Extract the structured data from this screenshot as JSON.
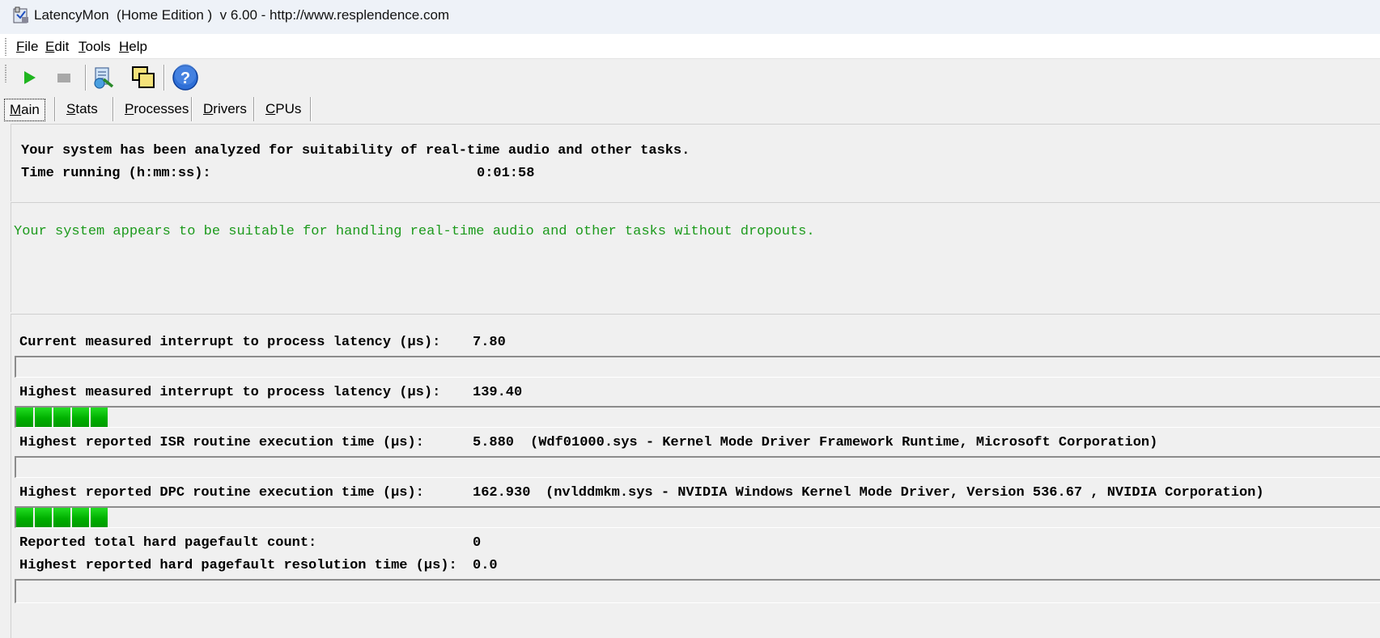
{
  "window": {
    "title": "LatencyMon  (Home Edition )  v 6.00 - http://www.resplendence.com"
  },
  "menu": [
    {
      "key": "F",
      "rest": "ile"
    },
    {
      "key": "E",
      "rest": "dit"
    },
    {
      "key": "T",
      "rest": "ools"
    },
    {
      "key": "H",
      "rest": "elp"
    }
  ],
  "toolbar": {
    "buttons": [
      "play-icon",
      "stop-icon",
      "analyze-icon",
      "windows-icon",
      "help-icon"
    ]
  },
  "tabs": [
    {
      "key": "M",
      "rest": "ain",
      "active": true
    },
    {
      "key": "S",
      "rest": "tats",
      "active": false
    },
    {
      "key": "P",
      "rest": "rocesses",
      "active": false
    },
    {
      "key": "D",
      "rest": "rivers",
      "active": false
    },
    {
      "key": "C",
      "rest": "PUs",
      "active": false
    }
  ],
  "summary": {
    "analyzed_text": "Your system has been analyzed for suitability of real-time audio and other tasks.",
    "time_label": "Time running (h:mm:ss):",
    "time_value": "0:01:58"
  },
  "verdict": {
    "text": "Your system appears to be suitable for handling real-time audio and other tasks without dropouts.",
    "color": "#1c9a1c"
  },
  "metrics": {
    "current_latency": {
      "label": "Current measured interrupt to process latency (µs):",
      "value": "7.80",
      "bar_segments": 0
    },
    "highest_latency": {
      "label": "Highest measured interrupt to process latency (µs):",
      "value": "139.40",
      "bar_segments": 5
    },
    "isr": {
      "label": "Highest reported ISR routine execution time (µs):",
      "value": "5.880",
      "detail": "(Wdf01000.sys - Kernel Mode Driver Framework Runtime, Microsoft Corporation)",
      "bar_segments": 0
    },
    "dpc": {
      "label": "Highest reported DPC routine execution time (µs):",
      "value": "162.930",
      "detail": "(nvlddmkm.sys - NVIDIA Windows Kernel Mode Driver, Version 536.67 , NVIDIA Corporation)",
      "bar_segments": 5
    },
    "pagefault_count": {
      "label": "Reported total hard pagefault count:",
      "value": "0"
    },
    "pagefault_time": {
      "label": "Highest reported hard pagefault resolution time (µs):",
      "value": "0.0"
    }
  },
  "colors": {
    "meter_green": "#00b000",
    "meter_green_light": "#22dd22"
  }
}
